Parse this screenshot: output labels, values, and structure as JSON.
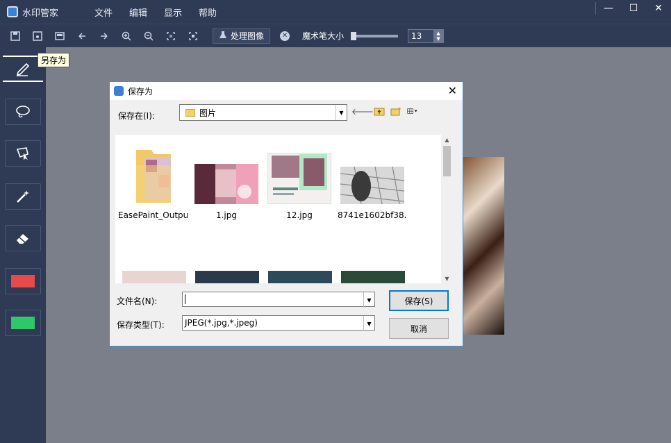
{
  "app": {
    "title": "水印管家",
    "menu": [
      "文件",
      "编辑",
      "显示",
      "帮助"
    ],
    "window_controls": [
      "—",
      "☐",
      "✕"
    ]
  },
  "toolbar": {
    "icons": [
      "save-icon",
      "save-as-icon",
      "export-icon",
      "undo-icon",
      "redo-icon",
      "zoom-in-icon",
      "zoom-out-icon",
      "actual-size-icon",
      "fit-window-icon"
    ],
    "process_label": "处理图像",
    "brush_size_label": "魔术笔大小",
    "brush_size_value": "13",
    "brush_size_fraction": 0.0
  },
  "tooltip": "另存为",
  "sidebar": {
    "tools": [
      "pen-tool",
      "lasso-tool",
      "polygon-lasso-tool",
      "magic-wand-tool",
      "eraser-tool"
    ],
    "colors": [
      "#e84a4a",
      "#2ec76a"
    ]
  },
  "dialog": {
    "title": "保存为",
    "look_in_label": "保存在(I):",
    "look_in_value": "图片",
    "files": [
      {
        "name": "EasePaint_Output",
        "kind": "folder"
      },
      {
        "name": "1.jpg",
        "kind": "image"
      },
      {
        "name": "12.jpg",
        "kind": "image"
      },
      {
        "name": "8741e1602bf38...",
        "kind": "image"
      }
    ],
    "file_name_label": "文件名(N):",
    "file_name_value": "",
    "file_type_label": "保存类型(T):",
    "file_type_value": "JPEG(*.jpg,*.jpeg)",
    "save_label": "保存(S)",
    "cancel_label": "取消"
  }
}
